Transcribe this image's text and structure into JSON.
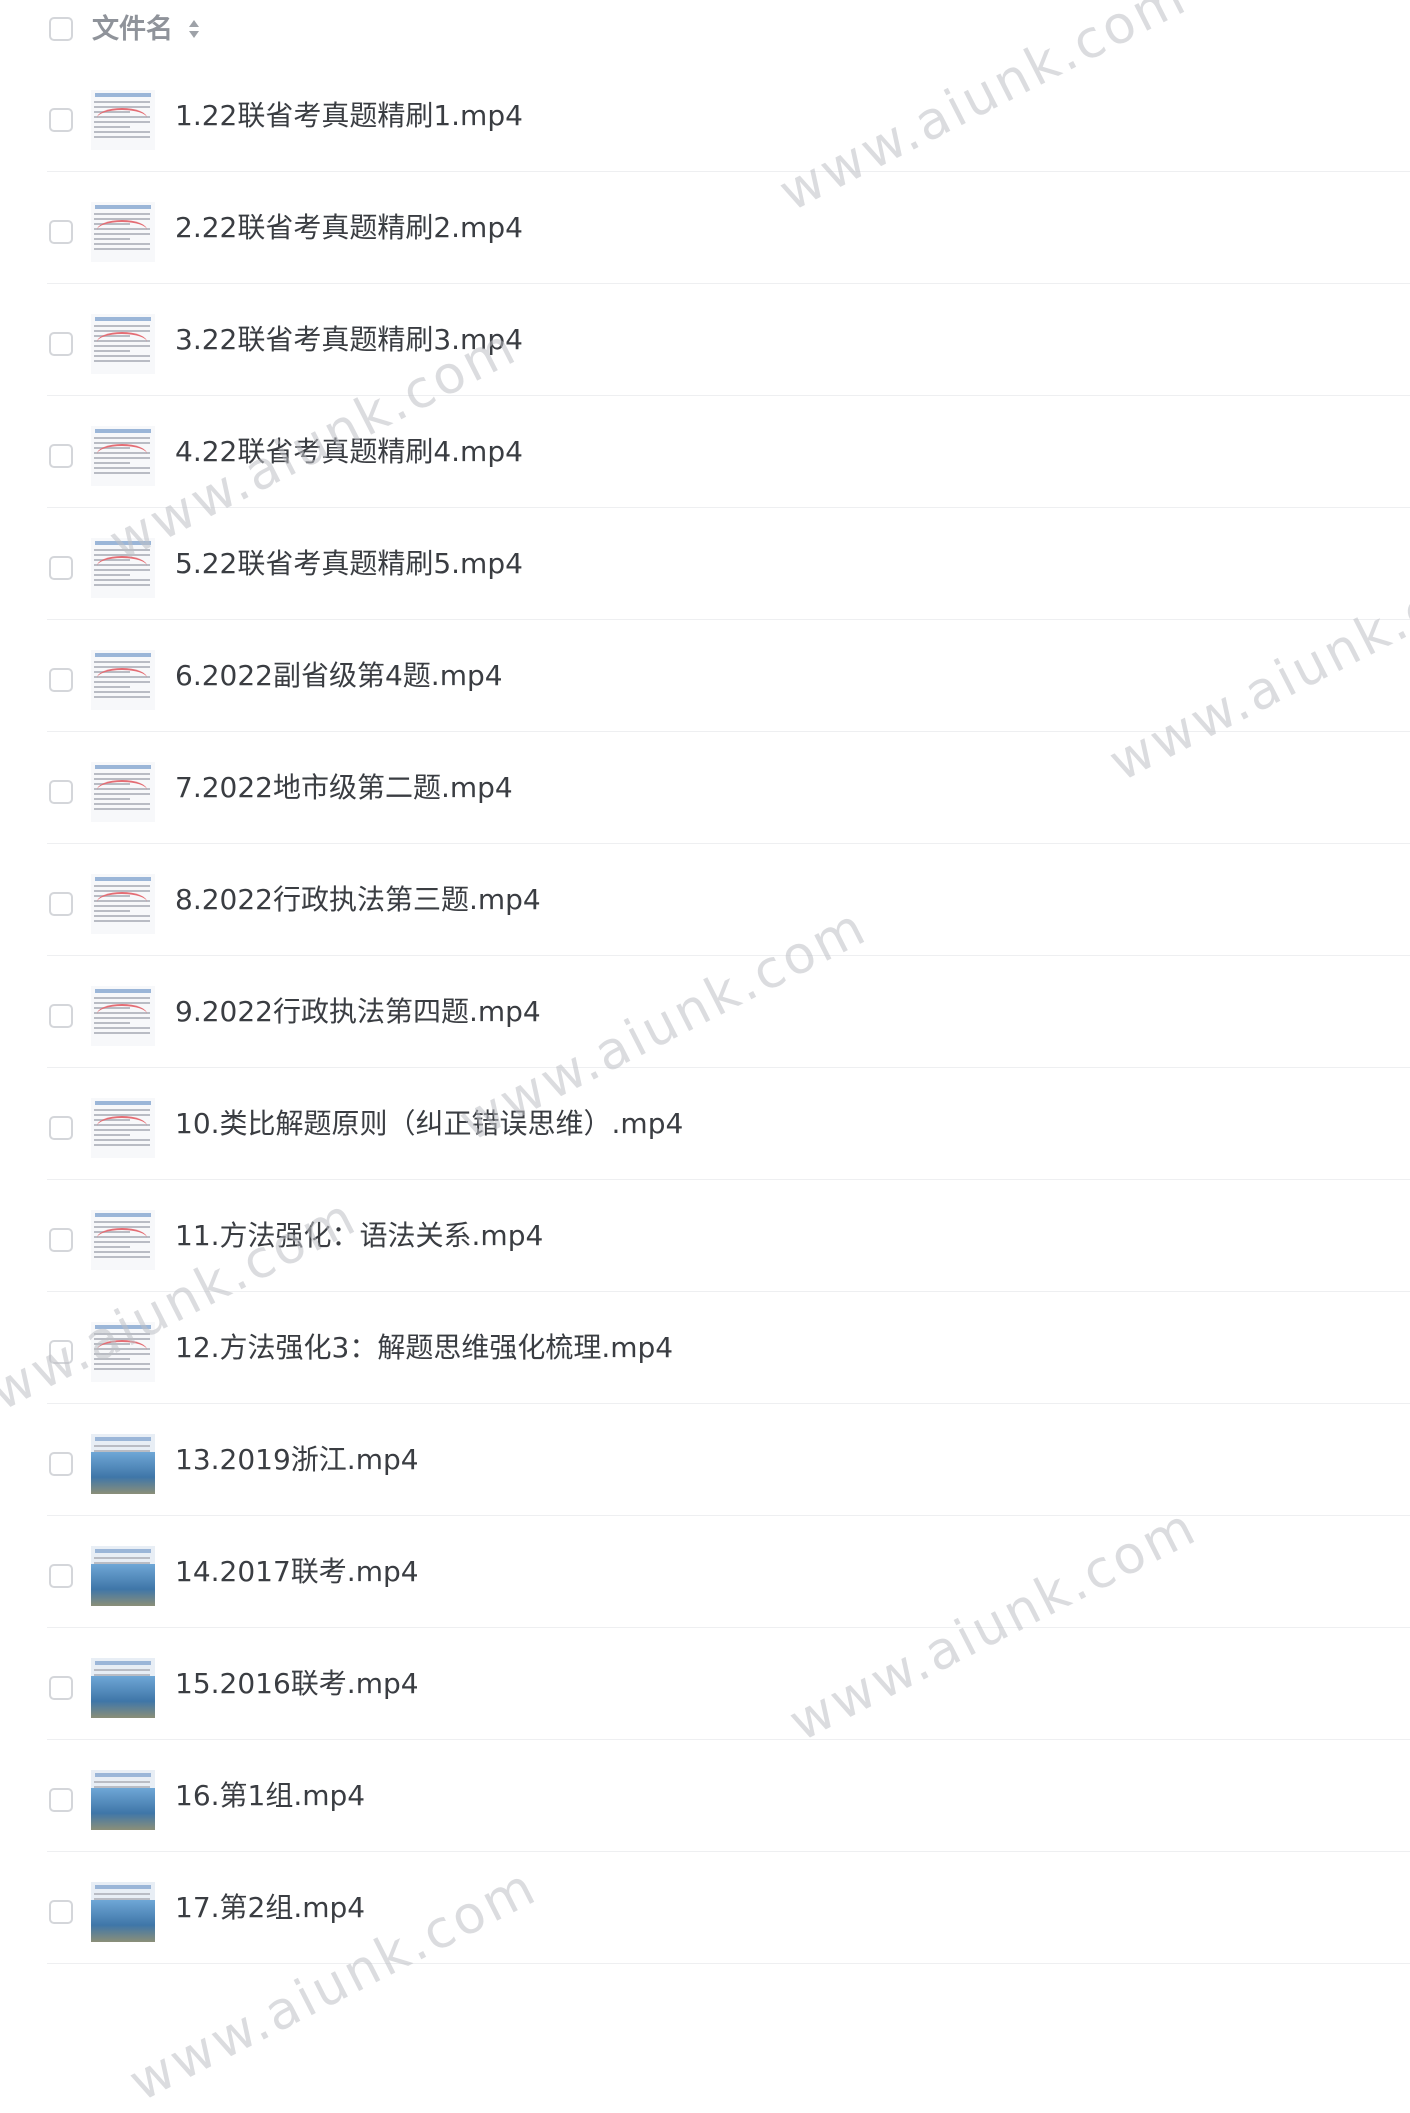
{
  "header": {
    "column_label": "文件名"
  },
  "files": [
    {
      "name": "1.22联省考真题精刷1.mp4",
      "thumb": "doc"
    },
    {
      "name": "2.22联省考真题精刷2.mp4",
      "thumb": "doc"
    },
    {
      "name": "3.22联省考真题精刷3.mp4",
      "thumb": "doc"
    },
    {
      "name": "4.22联省考真题精刷4.mp4",
      "thumb": "doc"
    },
    {
      "name": "5.22联省考真题精刷5.mp4",
      "thumb": "doc"
    },
    {
      "name": "6.2022副省级第4题.mp4",
      "thumb": "doc"
    },
    {
      "name": "7.2022地市级第二题.mp4",
      "thumb": "doc"
    },
    {
      "name": "8.2022行政执法第三题.mp4",
      "thumb": "doc"
    },
    {
      "name": "9.2022行政执法第四题.mp4",
      "thumb": "doc"
    },
    {
      "name": "10.类比解题原则（纠正错误思维）.mp4",
      "thumb": "doc"
    },
    {
      "name": "11.方法强化：语法关系.mp4",
      "thumb": "doc"
    },
    {
      "name": "12.方法强化3：解题思维强化梳理.mp4",
      "thumb": "doc"
    },
    {
      "name": "13.2019浙江.mp4",
      "thumb": "photo"
    },
    {
      "name": "14.2017联考.mp4",
      "thumb": "photo"
    },
    {
      "name": "15.2016联考.mp4",
      "thumb": "photo"
    },
    {
      "name": "16.第1组.mp4",
      "thumb": "photo"
    },
    {
      "name": "17.第2组.mp4",
      "thumb": "photo"
    }
  ],
  "watermark_text": "www.aiunk.com"
}
